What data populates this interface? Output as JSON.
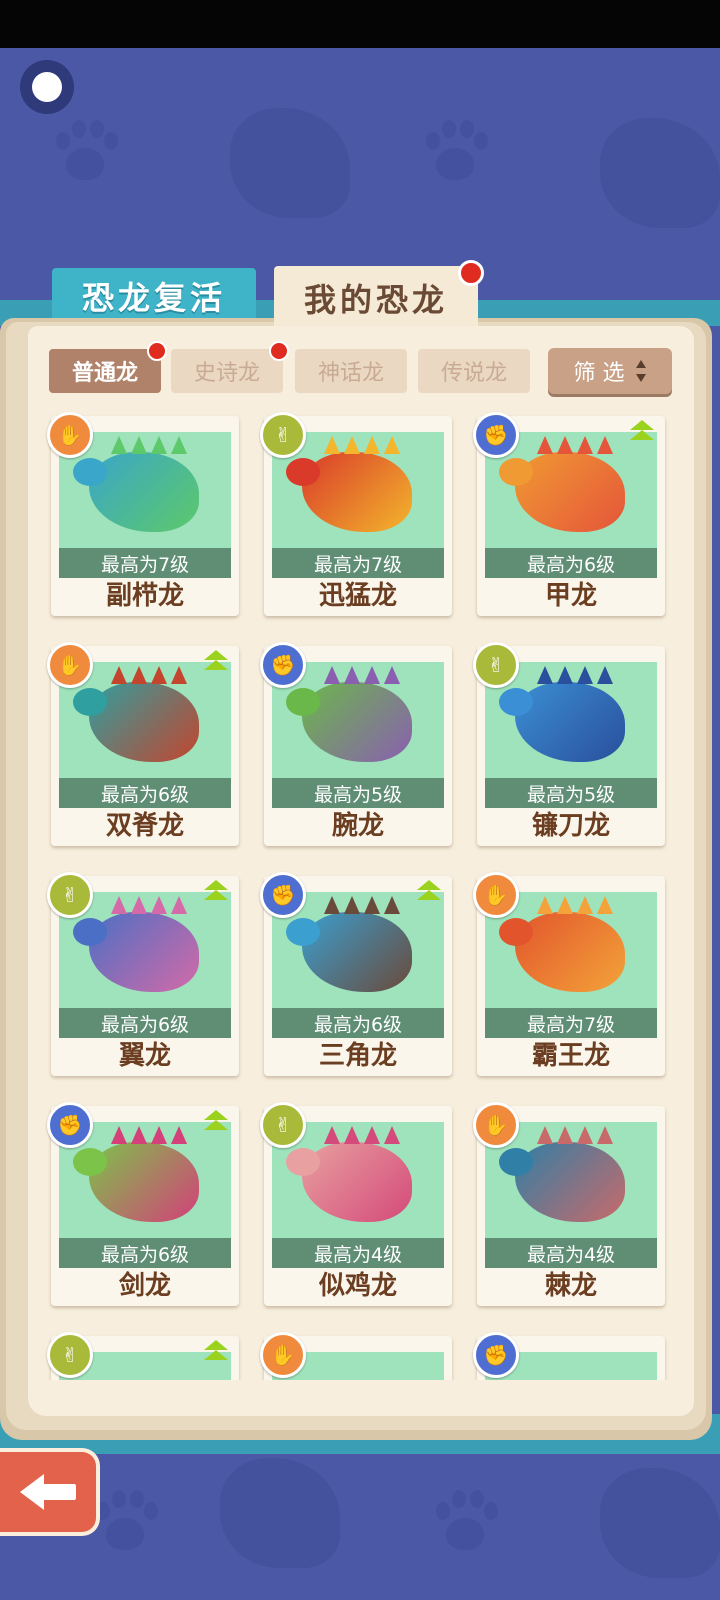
{
  "main_tabs": [
    {
      "label": "恐龙复活",
      "active": false
    },
    {
      "label": "我的恐龙",
      "active": true,
      "has_notification": true
    }
  ],
  "category_tabs": [
    {
      "label": "普通龙",
      "active": true,
      "has_notification": true
    },
    {
      "label": "史诗龙",
      "active": false,
      "has_notification": true
    },
    {
      "label": "神话龙",
      "active": false
    },
    {
      "label": "传说龙",
      "active": false
    }
  ],
  "filter": {
    "label": "筛 选"
  },
  "dinosaurs": [
    {
      "name": "副栉龙",
      "level": "最高为7级",
      "hand": "paper",
      "upgradable": false,
      "colors": [
        "#3aa6c9",
        "#5dc96a"
      ]
    },
    {
      "name": "迅猛龙",
      "level": "最高为7级",
      "hand": "scissors",
      "upgradable": false,
      "colors": [
        "#d93a2a",
        "#f3b62c"
      ]
    },
    {
      "name": "甲龙",
      "level": "最高为6级",
      "hand": "rock",
      "upgradable": true,
      "colors": [
        "#f09a33",
        "#e5553a"
      ]
    },
    {
      "name": "双脊龙",
      "level": "最高为6级",
      "hand": "paper",
      "upgradable": true,
      "colors": [
        "#2f9fa0",
        "#c4452e"
      ]
    },
    {
      "name": "腕龙",
      "level": "最高为5级",
      "hand": "rock",
      "upgradable": false,
      "colors": [
        "#6bb84a",
        "#8a5fb0"
      ]
    },
    {
      "name": "镰刀龙",
      "level": "最高为5级",
      "hand": "scissors",
      "upgradable": false,
      "colors": [
        "#3b8fd4",
        "#2a4f9c"
      ]
    },
    {
      "name": "翼龙",
      "level": "最高为6级",
      "hand": "scissors",
      "upgradable": true,
      "colors": [
        "#4b6fc4",
        "#d46aa8"
      ]
    },
    {
      "name": "三角龙",
      "level": "最高为6级",
      "hand": "rock",
      "upgradable": true,
      "colors": [
        "#3b9fd0",
        "#6a4a3a"
      ]
    },
    {
      "name": "霸王龙",
      "level": "最高为7级",
      "hand": "paper",
      "upgradable": false,
      "colors": [
        "#e2552c",
        "#f3a33a"
      ]
    },
    {
      "name": "剑龙",
      "level": "最高为6级",
      "hand": "rock",
      "upgradable": true,
      "colors": [
        "#7cc34a",
        "#d4407a"
      ]
    },
    {
      "name": "似鸡龙",
      "level": "最高为4级",
      "hand": "scissors",
      "upgradable": false,
      "colors": [
        "#e8a0a0",
        "#d44a7a"
      ]
    },
    {
      "name": "棘龙",
      "level": "最高为4级",
      "hand": "paper",
      "upgradable": false,
      "colors": [
        "#2f7fa6",
        "#c96a6a"
      ]
    },
    {
      "name": "",
      "level": "",
      "hand": "scissors",
      "upgradable": true,
      "colors": [
        "#9ee3bc",
        "#9ee3bc"
      ]
    },
    {
      "name": "",
      "level": "",
      "hand": "paper",
      "upgradable": false,
      "colors": [
        "#9ee3bc",
        "#9ee3bc"
      ]
    },
    {
      "name": "",
      "level": "",
      "hand": "rock",
      "upgradable": false,
      "colors": [
        "#9ee3bc",
        "#9ee3bc"
      ]
    }
  ],
  "hand_icons": {
    "paper": "✋",
    "scissors": "✌",
    "rock": "✊"
  },
  "hand_colors": {
    "paper": "#f08a3c",
    "scissors": "#a9b93a",
    "rock": "#4f6ed1"
  },
  "back_button": {
    "icon": "back-arrow-icon"
  },
  "menu_button": {
    "icon": "menu-dot-icon"
  }
}
